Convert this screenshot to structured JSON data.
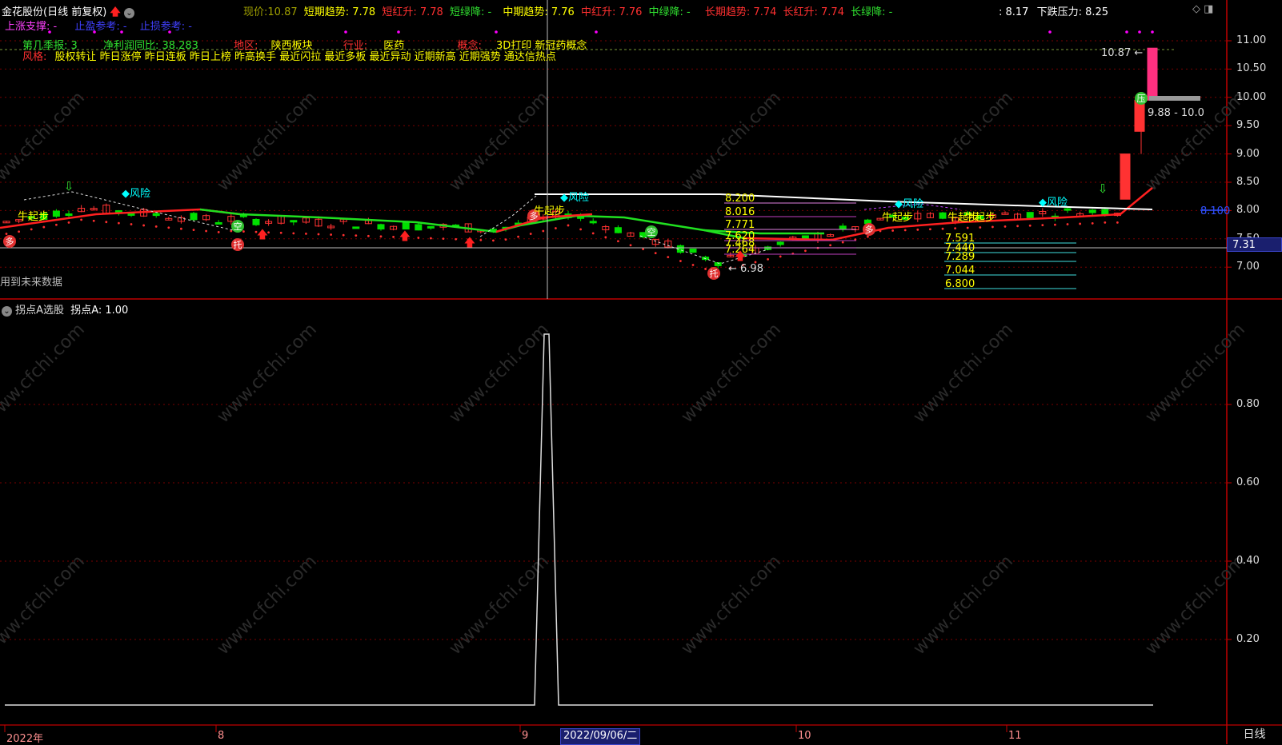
{
  "header": {
    "stock_name": "金花股份(日线 前复权)",
    "price_label": "现价:",
    "price_value": "10.87",
    "short_trend": "短期趋势: 7.78",
    "short_red": "短红升: 7.78",
    "short_green": "短绿降: -",
    "mid_trend": "中期趋势: 7.76",
    "mid_red": "中红升: 7.76",
    "mid_green": "中绿降: -",
    "long_trend": "长期趋势: 7.74",
    "long_red": "长红升: 7.74",
    "long_green": "长绿降: -",
    "extra_value": ": 8.17",
    "down_pressure": "下跌压力: 8.25"
  },
  "legend_row2": {
    "support": "上涨支撑: -",
    "profit": "止盈参考: -",
    "loss": "止损参考: -"
  },
  "info_row": {
    "quarter": "第几季报: 3",
    "profit_yoy": "净利润同比: 38.283",
    "region_label": "地区:",
    "region_value": "陕西板块",
    "industry_label": "行业:",
    "industry_value": "医药",
    "concept_label": "概念:",
    "concept_value": "3D打印 新冠药概念"
  },
  "style_row": {
    "label": "风格:",
    "value": "股权转让 昨日涨停 昨日连板 昨日上榜 昨高换手 最近闪拉 最近多板 最近异动 近期新高 近期强势 通达信热点"
  },
  "future_note": "用到未来数据",
  "chart_labels": {
    "bull_start": "牛起步",
    "risk": "◆风险",
    "duo": "多",
    "kong": "空",
    "tuo": "托",
    "ya": "压",
    "high_mark": "10.87",
    "low_mark": "6.98",
    "pressure_range": "9.88 - 10.0",
    "blue_level": "8.100"
  },
  "fib_levels_upper": [
    "8.200",
    "8.016",
    "7.771",
    "7.620",
    "7.468",
    "7.264"
  ],
  "fib_levels_lower": [
    "7.591",
    "7.440",
    "7.289",
    "7.044",
    "6.800"
  ],
  "price_axis": {
    "ticks": [
      "11.00",
      "10.50",
      "10.00",
      "9.50",
      "9.00",
      "8.50",
      "8.00",
      "7.50",
      "7.00"
    ],
    "cursor_value": "7.31"
  },
  "indicator": {
    "title": "拐点A选股",
    "value_text": "拐点A: 1.00",
    "axis_ticks": [
      "0.80",
      "0.60",
      "0.40",
      "0.20"
    ]
  },
  "time_axis": {
    "labels": [
      "2022年",
      "8",
      "9",
      "10",
      "11"
    ],
    "cursor_date": "2022/09/06/二",
    "period": "日线"
  },
  "watermark": "www.cfchi.com",
  "colors": {
    "up": "#ff3232",
    "down": "#00e000",
    "trend_red": "#ff2020",
    "trend_green": "#20e020",
    "gridline": "#7a0000",
    "axis_border": "#c00000",
    "label_yellow": "#ffff00",
    "label_cyan": "#00ffff",
    "label_magenta": "#ff00ff"
  }
}
